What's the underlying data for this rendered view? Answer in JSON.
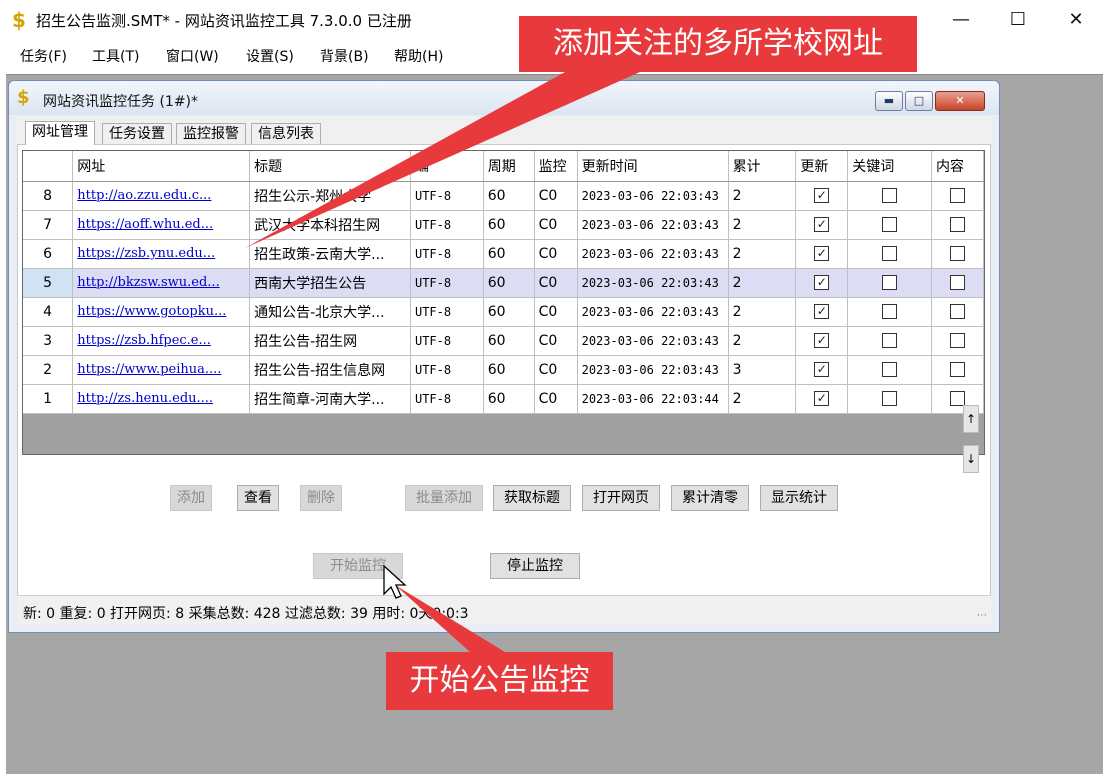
{
  "window": {
    "title": "招生公告监测.SMT* - 网站资讯监控工具 7.3.0.0  已注册",
    "app_icon": "$"
  },
  "menu": [
    "任务(F)",
    "工具(T)",
    "窗口(W)",
    "设置(S)",
    "背景(B)",
    "帮助(H)"
  ],
  "child": {
    "title": "网站资讯监控任务  (1#)*"
  },
  "tabs": [
    "网址管理",
    "任务设置",
    "监控报警",
    "信息列表"
  ],
  "table": {
    "columns": [
      "",
      "网址",
      "标题",
      "编",
      "周期",
      "监控",
      "更新时间",
      "累计",
      "更新",
      "关键词",
      "内容"
    ],
    "rows": [
      {
        "num": "8",
        "url": "http://ao.zzu.edu.c...",
        "title": "招生公示-郑州大学",
        "enc": "UTF-8",
        "period": "60",
        "mon": "C0",
        "time": "2023-03-06 22:03:43",
        "count": "2",
        "upd": true,
        "kw": false,
        "content": false
      },
      {
        "num": "7",
        "url": "https://aoff.whu.ed...",
        "title": "武汉大学本科招生网",
        "enc": "UTF-8",
        "period": "60",
        "mon": "C0",
        "time": "2023-03-06 22:03:43",
        "count": "2",
        "upd": true,
        "kw": false,
        "content": false
      },
      {
        "num": "6",
        "url": "https://zsb.ynu.edu...",
        "title": "招生政策-云南大学...",
        "enc": "UTF-8",
        "period": "60",
        "mon": "C0",
        "time": "2023-03-06 22:03:43",
        "count": "2",
        "upd": true,
        "kw": false,
        "content": false
      },
      {
        "num": "5",
        "url": "http://bkzsw.swu.ed...",
        "title": "西南大学招生公告",
        "enc": "UTF-8",
        "period": "60",
        "mon": "C0",
        "time": "2023-03-06 22:03:43",
        "count": "2",
        "upd": true,
        "kw": false,
        "content": false,
        "selected": true
      },
      {
        "num": "4",
        "url": "https://www.gotopku...",
        "title": "通知公告-北京大学...",
        "enc": "UTF-8",
        "period": "60",
        "mon": "C0",
        "time": "2023-03-06 22:03:43",
        "count": "2",
        "upd": true,
        "kw": false,
        "content": false
      },
      {
        "num": "3",
        "url": "https://zsb.hfpec.e...",
        "title": "招生公告-招生网",
        "enc": "UTF-8",
        "period": "60",
        "mon": "C0",
        "time": "2023-03-06 22:03:43",
        "count": "2",
        "upd": true,
        "kw": false,
        "content": false
      },
      {
        "num": "2",
        "url": "https://www.peihua....",
        "title": "招生公告-招生信息网",
        "enc": "UTF-8",
        "period": "60",
        "mon": "C0",
        "time": "2023-03-06 22:03:43",
        "count": "3",
        "upd": true,
        "kw": false,
        "content": false
      },
      {
        "num": "1",
        "url": "http://zs.henu.edu....",
        "title": "招生简章-河南大学...",
        "enc": "UTF-8",
        "period": "60",
        "mon": "C0",
        "time": "2023-03-06 22:03:44",
        "count": "2",
        "upd": true,
        "kw": false,
        "content": false
      }
    ]
  },
  "buttons": {
    "add": "添加",
    "view": "查看",
    "delete": "删除",
    "batch_add": "批量添加",
    "get_title": "获取标题",
    "open_page": "打开网页",
    "clear_count": "累计清零",
    "show_stats": "显示统计",
    "start": "开始监控",
    "stop": "停止监控"
  },
  "status": "新:  0  重复:  0  打开网页:  8  采集总数:  428  过滤总数:  39  用时:  0天0:0:3",
  "annotations": {
    "top": "添加关注的多所学校网址",
    "bottom": "开始公告监控"
  },
  "colors": {
    "callout": "#e8393d",
    "link": "#0000cc",
    "selected_row": "#dcdcf5"
  }
}
